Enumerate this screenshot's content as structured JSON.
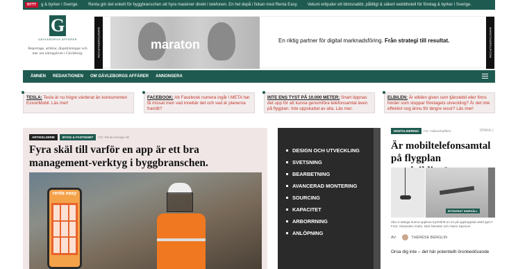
{
  "ticker": {
    "badge": "NYTT",
    "items": [
      "g & byrker i Sverige.",
      "Renta gör det enkelt för byggbranschen att hyra maskiner direkt i telefonen. En hel depå i fickan med Renta Easy.",
      "Velumi erbjuder ett blixtsnabbt, pålitligt & säkert webbhotell för företag & byrker i Sverige."
    ]
  },
  "header": {
    "logo_letter": "G",
    "logo_name": "GÄVLEBORGS AFFÄRER",
    "tagline": "Reportage, artiklar, djupdykningar och mer om näringslivet i Gävleborg."
  },
  "banner": {
    "side_left": "MARATONGROUP.COM",
    "side_right": "MARATONGROUP.COM",
    "brand": "maraton",
    "text_plain": "En riktig partner för digital marknadsföring.",
    "text_bold": "Från strategi till resultat."
  },
  "nav": {
    "items": [
      "ÄMNEN",
      "REDAKTIONEN",
      "OM GÄVLEBORGS AFFÄRER",
      "ANNONSERA"
    ]
  },
  "news": [
    {
      "label": "TESLA:",
      "text": "Tesla är nu högre värderat än konkurrenten ExxonMobil. Läs mer!"
    },
    {
      "label": "FACEBOOK:",
      "text": "Att Facebook numera ingår i META har få missat men vad innebär det och vad är planerna framåt?"
    },
    {
      "label": "INTE ENS TYST PÅ 10.000 METER:",
      "text": "Snart öppnas det upp för att kunna genomföra telefonsamtal även på flygplan. Inte uppskattat av alla. Läs mer."
    },
    {
      "label": "ELBILEN:",
      "text": "Är elbilen given som tjänstebil eller finns hinder som stoppar företagets utveckling? Är det inte effektivt nog ännu för längre resor? Läs mer!"
    }
  ],
  "article1": {
    "tag1": "ARTIKELSERIE",
    "tag2": "BYGG & FASTIGHET",
    "for": "För: Renta Sverige AB",
    "title": "Fyra skäl till varför en app är ett bra management-verktyg i byggbranschen.",
    "phone_brand": "renta easy"
  },
  "services": [
    "DESIGN OCH UTVECKLING",
    "SVETSNING",
    "BEARBETNING",
    "AVANCERAD MONTERING",
    "SOURCING",
    "KAPACITET",
    "ARBORRNING",
    "ANLÖPNING"
  ],
  "article2": {
    "tag": "DIGITALISERING",
    "for": "För: Hallandsaffärer",
    "save": "SPARA",
    "title": "Är mobiltelefonsamtal på flygplan oundvikliga?",
    "sponsor": "SPONSRAT INNEHÅLL",
    "caption": "Ska vi stänga kunna uppleva trycksfritt en en på uppkopplad värld igen? Foto: Alexander Andrs, Nick Morales och Owen Spencer.",
    "author_prefix": "AV:",
    "author": "THERÉSE BERGLIN",
    "teaser": "Oroa dig inte – det här potentiellt öronbedövande"
  }
}
